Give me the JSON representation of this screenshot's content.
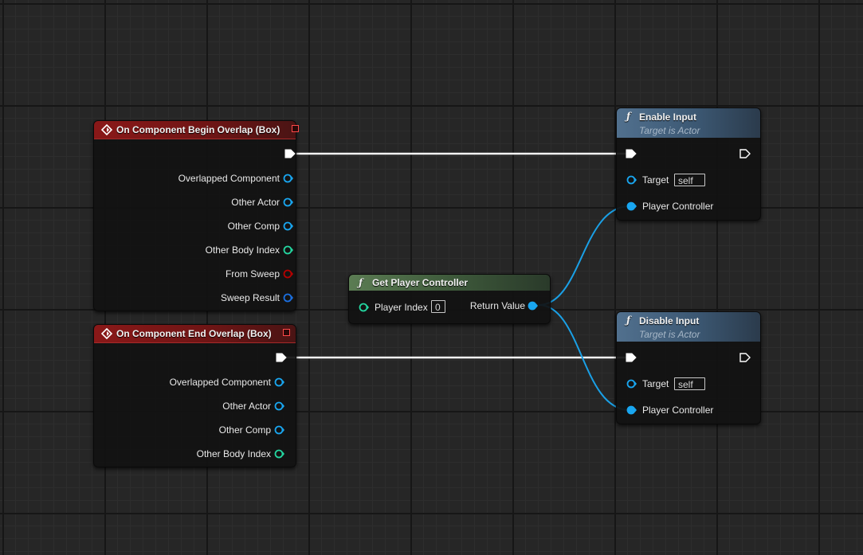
{
  "colors": {
    "exec_wire": "#ffffff",
    "object_pin": "#19a6f0",
    "int_pin": "#24d6a0",
    "bool_pin": "#b40000",
    "struct_pin": "#1b6fe0",
    "event_header": "#8a1818",
    "pure_header": "#5b7c53",
    "function_header": "#51708e"
  },
  "nodes": {
    "begin_overlap": {
      "title": "On Component Begin Overlap (Box)",
      "icon": "event-diamond-icon",
      "outputs": [
        {
          "label": "Overlapped Component",
          "type": "object"
        },
        {
          "label": "Other Actor",
          "type": "object"
        },
        {
          "label": "Other Comp",
          "type": "object"
        },
        {
          "label": "Other Body Index",
          "type": "int"
        },
        {
          "label": "From Sweep",
          "type": "bool"
        },
        {
          "label": "Sweep Result",
          "type": "struct"
        }
      ]
    },
    "end_overlap": {
      "title": "On Component End Overlap (Box)",
      "icon": "event-diamond-icon",
      "outputs": [
        {
          "label": "Overlapped Component",
          "type": "object"
        },
        {
          "label": "Other Actor",
          "type": "object"
        },
        {
          "label": "Other Comp",
          "type": "object"
        },
        {
          "label": "Other Body Index",
          "type": "int"
        }
      ]
    },
    "get_player_controller": {
      "title": "Get Player Controller",
      "icon": "function-icon",
      "input_label": "Player Index",
      "input_value": "0",
      "output_label": "Return Value"
    },
    "enable_input": {
      "title": "Enable Input",
      "subtitle": "Target is Actor",
      "icon": "function-icon",
      "target_label": "Target",
      "target_value": "self",
      "controller_label": "Player Controller"
    },
    "disable_input": {
      "title": "Disable Input",
      "subtitle": "Target is Actor",
      "icon": "function-icon",
      "target_label": "Target",
      "target_value": "self",
      "controller_label": "Player Controller"
    }
  }
}
